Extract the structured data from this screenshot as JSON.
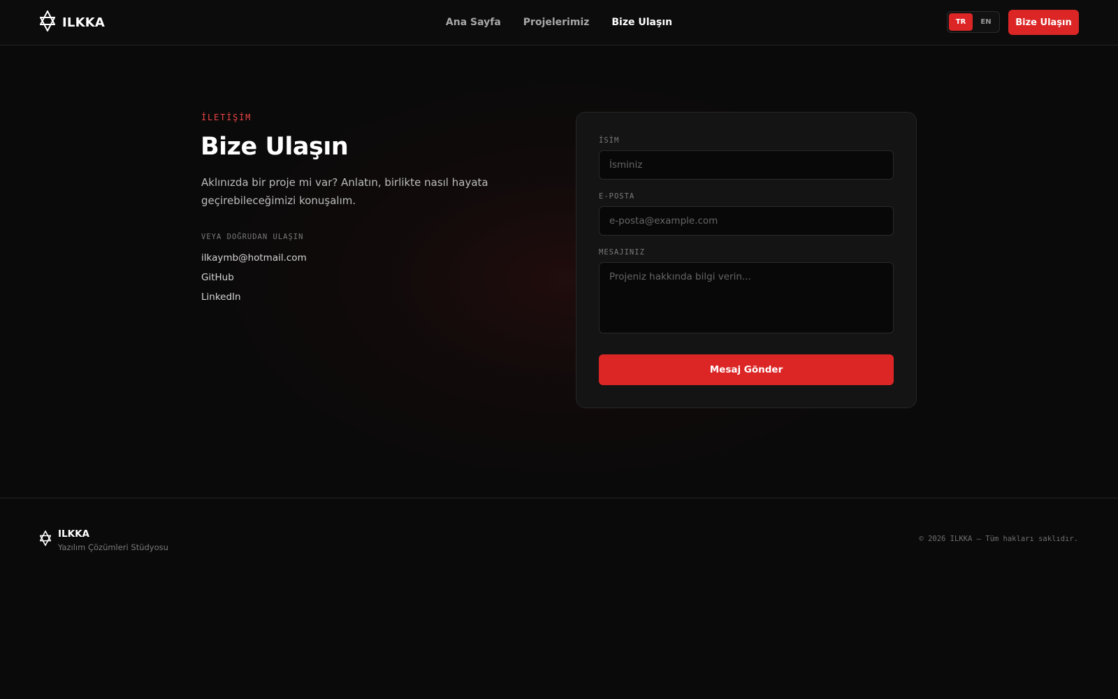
{
  "header": {
    "brand": "ILKKA",
    "nav": [
      {
        "label": "Ana Sayfa",
        "active": false
      },
      {
        "label": "Projelerimiz",
        "active": false
      },
      {
        "label": "Bize Ulaşın",
        "active": true
      }
    ],
    "languages": [
      {
        "label": "TR",
        "active": true
      },
      {
        "label": "EN",
        "active": false
      }
    ],
    "cta_label": "Bize Ulaşın",
    "logo_icon": "hexagram-icon"
  },
  "contact": {
    "eyebrow": "İLETİŞİM",
    "title": "Bize Ulaşın",
    "lead": "Aklınızda bir proje mi var? Anlatın, birlikte nasıl hayata geçirebileceğimizi konuşalım.",
    "direct_label": "VEYA DOĞRUDAN ULAŞIN",
    "links": {
      "email": "ilkaymb@hotmail.com",
      "github": "GitHub",
      "linkedin": "LinkedIn"
    }
  },
  "form": {
    "name_label": "İSİM",
    "name_placeholder": "İsminiz",
    "name_value": "",
    "email_label": "E-POSTA",
    "email_placeholder": "e-posta@example.com",
    "email_value": "",
    "message_label": "MESAJINIZ",
    "message_placeholder": "Projeniz hakkında bilgi verin...",
    "message_value": "",
    "submit_label": "Mesaj Gönder"
  },
  "footer": {
    "brand": "ILKKA",
    "tagline": "Yazılım Çözümleri Stüdyosu",
    "copyright": "© 2026 ILKKA — Tüm hakları saklıdır."
  },
  "colors": {
    "accent": "#dc2626",
    "background": "#0a0a0a",
    "card": "#141414",
    "eyebrow": "#ef4444"
  }
}
